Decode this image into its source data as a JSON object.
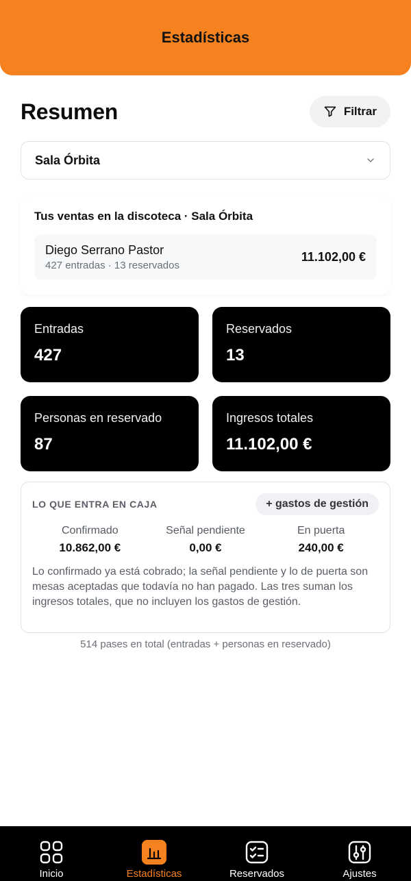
{
  "header": {
    "title": "Estadísticas"
  },
  "summary": {
    "title": "Resumen",
    "filter_label": "Filtrar"
  },
  "venue_select": {
    "selected": "Sala Órbita"
  },
  "sales": {
    "title": "Tus ventas en la discoteca · Sala Órbita",
    "seller": {
      "name": "Diego Serrano Pastor",
      "detail": "427 entradas · 13 reservados",
      "amount": "11.102,00 €"
    }
  },
  "stats": [
    {
      "label": "Entradas",
      "value": "427"
    },
    {
      "label": "Reservados",
      "value": "13"
    },
    {
      "label": "Personas en reservado",
      "value": "87"
    },
    {
      "label": "Ingresos totales",
      "value": "11.102,00 €"
    }
  ],
  "cash": {
    "title": "LO QUE ENTRA EN CAJA",
    "fees_label": "+ gastos de gestión",
    "columns": [
      {
        "label": "Confirmado",
        "value": "10.862,00 €"
      },
      {
        "label": "Señal pendiente",
        "value": "0,00 €"
      },
      {
        "label": "En puerta",
        "value": "240,00 €"
      }
    ],
    "note": "Lo confirmado ya está cobrado; la señal pendiente y lo de puerta son mesas aceptadas que todavía no han pagado. Las tres suman los ingresos totales, que no incluyen los gastos de gestión."
  },
  "total_passes": "514 pases en total (entradas + personas en reservado)",
  "nav": [
    {
      "label": "Inicio",
      "icon": "grid-icon",
      "active": false
    },
    {
      "label": "Estadísticas",
      "icon": "bar-chart-icon",
      "active": true
    },
    {
      "label": "Reservados",
      "icon": "checklist-icon",
      "active": false
    },
    {
      "label": "Ajustes",
      "icon": "sliders-icon",
      "active": false
    }
  ],
  "colors": {
    "accent": "#f5821f",
    "card_dark": "#000000",
    "nav_bg": "#000000"
  }
}
